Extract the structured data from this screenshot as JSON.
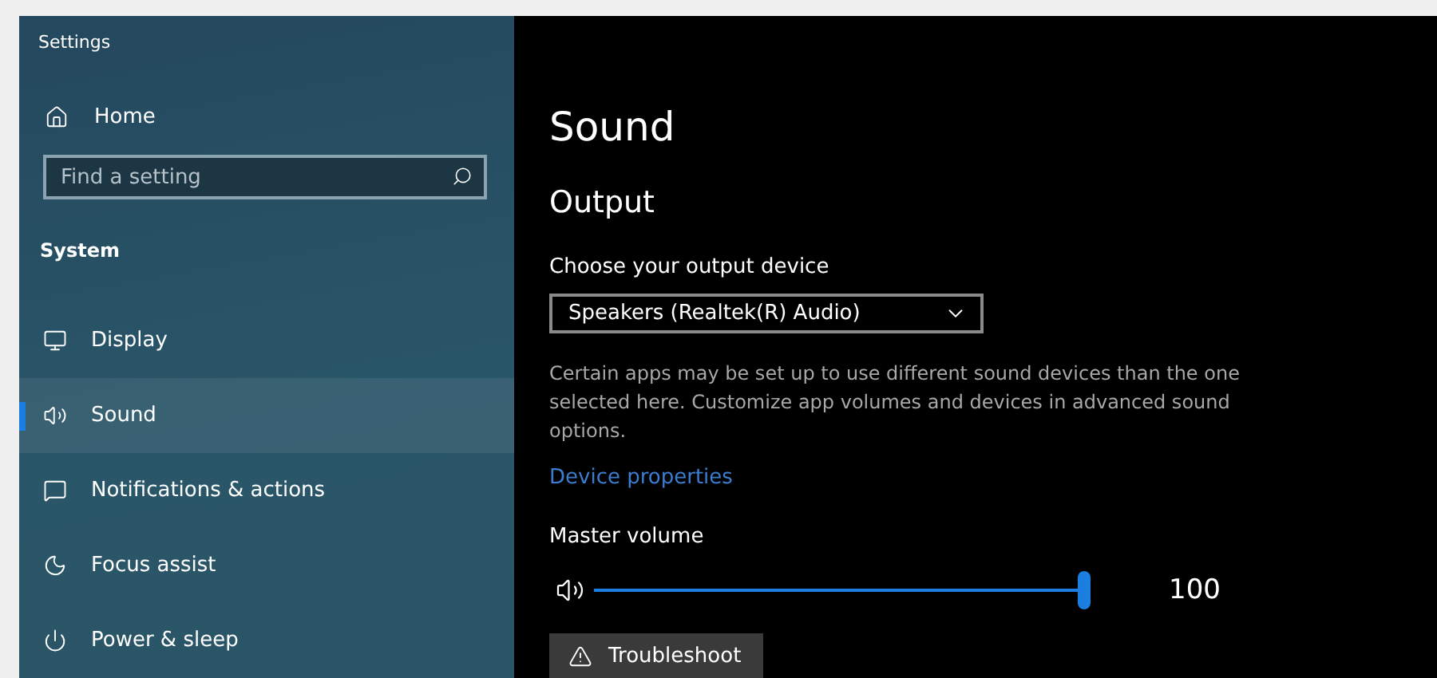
{
  "window": {
    "title": "Settings"
  },
  "sidebar": {
    "home": "Home",
    "search": {
      "placeholder": "Find a setting"
    },
    "section": "System",
    "items": [
      {
        "label": "Display",
        "selected": false
      },
      {
        "label": "Sound",
        "selected": true
      },
      {
        "label": "Notifications & actions",
        "selected": false
      },
      {
        "label": "Focus assist",
        "selected": false
      },
      {
        "label": "Power & sleep",
        "selected": false
      }
    ]
  },
  "main": {
    "title": "Sound",
    "section": "Output",
    "device_label": "Choose your output device",
    "device": {
      "value": "Speakers (Realtek(R) Audio)"
    },
    "note": "Certain apps may be set up to use different sound devices than the one selected here. Customize app volumes and devices in advanced sound options.",
    "link": "Device properties",
    "volume": {
      "label": "Master volume",
      "level": 1.0,
      "reading": "100"
    },
    "troubleshoot": "Troubleshoot"
  }
}
